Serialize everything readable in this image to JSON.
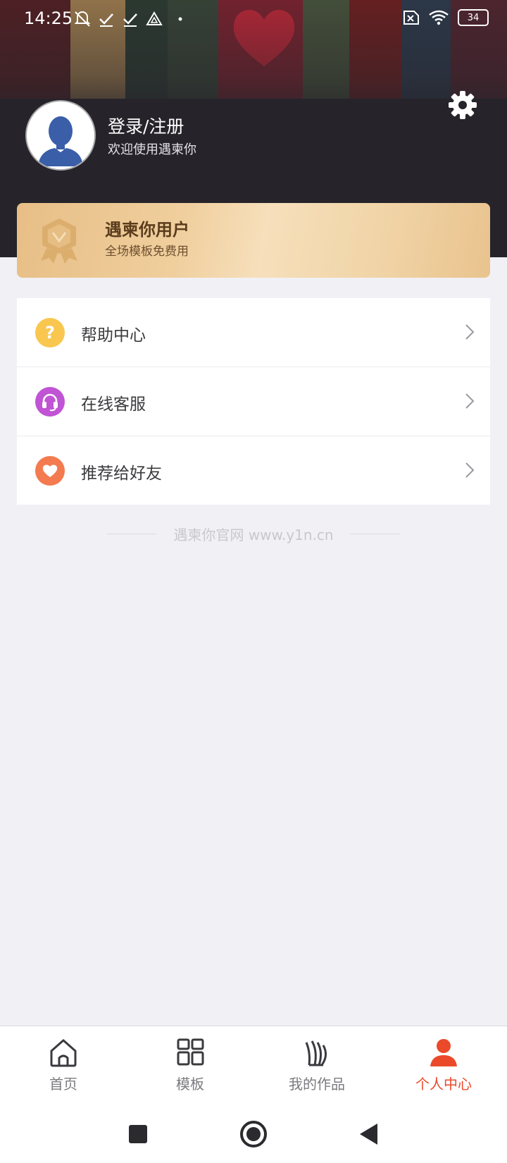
{
  "status_bar": {
    "time": "14:25",
    "battery": "34",
    "left_icons": [
      "mute-icon",
      "check-icon",
      "check-icon",
      "drive-icon",
      "dot-icon"
    ],
    "right_icons": [
      "sim-off-icon",
      "wifi-icon",
      "battery-icon"
    ]
  },
  "profile": {
    "login_title": "登录/注册",
    "welcome": "欢迎使用遇柬你",
    "avatar_icon": "default-avatar-icon",
    "settings_icon": "gear-icon"
  },
  "vip": {
    "title": "遇柬你用户",
    "subtitle": "全场模板免费用",
    "badge_icon": "vip-badge-icon"
  },
  "menu": {
    "items": [
      {
        "label": "帮助中心",
        "icon": "help-icon",
        "color": "#f9c74f"
      },
      {
        "label": "在线客服",
        "icon": "headset-icon",
        "color": "#c054d4"
      },
      {
        "label": "推荐给好友",
        "icon": "heart-icon",
        "color": "#f47a50"
      }
    ]
  },
  "footer": {
    "text": "遇柬你官网 www.y1n.cn"
  },
  "tabbar": {
    "tabs": [
      {
        "label": "首页",
        "icon": "home-icon"
      },
      {
        "label": "模板",
        "icon": "templates-icon"
      },
      {
        "label": "我的作品",
        "icon": "works-icon"
      },
      {
        "label": "个人中心",
        "icon": "person-icon",
        "active": true
      }
    ],
    "active_color": "#ea4a2a"
  },
  "system_nav": {
    "buttons": [
      "recents-icon",
      "home-circle-icon",
      "back-icon"
    ]
  },
  "colors": {
    "header_bg": "#26242a",
    "page_bg": "#f1f0f5",
    "vip_gold": "#efcd9b"
  }
}
